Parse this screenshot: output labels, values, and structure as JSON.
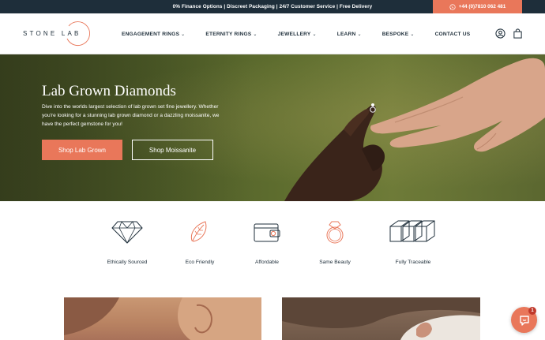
{
  "topbar": {
    "announcement": "0% Finance Options  |  Discreet Packaging  |  24/7 Customer Service  |  Free Delivery",
    "phone": "+44 (0)7810 062 481"
  },
  "header": {
    "logo_text": "STONE LAB",
    "nav": [
      {
        "label": "ENGAGEMENT RINGS",
        "has_dropdown": true
      },
      {
        "label": "ETERNITY RINGS",
        "has_dropdown": true
      },
      {
        "label": "JEWELLERY",
        "has_dropdown": true
      },
      {
        "label": "LEARN",
        "has_dropdown": true
      },
      {
        "label": "BESPOKE",
        "has_dropdown": true
      },
      {
        "label": "CONTACT US",
        "has_dropdown": false
      }
    ],
    "icons": [
      "account-icon",
      "bag-icon"
    ]
  },
  "hero": {
    "title": "Lab Grown Diamonds",
    "description": "Dive into the worlds largest selection of lab grown set fine jewellery. Whether you're looking for a stunning lab grown diamond or a dazzling moissanite, we have the perfect gemstone for you!",
    "primary_button": "Shop Lab Grown",
    "secondary_button": "Shop Moissanite"
  },
  "features": [
    {
      "label": "Ethically Sourced",
      "icon": "diamond-icon"
    },
    {
      "label": "Eco Friendly",
      "icon": "leaf-icon"
    },
    {
      "label": "Affordable",
      "icon": "wallet-icon"
    },
    {
      "label": "Same Beauty",
      "icon": "ring-icon"
    },
    {
      "label": "Fully Traceable",
      "icon": "cubes-icon"
    }
  ],
  "chat": {
    "badge_count": "1"
  },
  "colors": {
    "dark_navy": "#1e2e3a",
    "accent": "#e9775a"
  }
}
